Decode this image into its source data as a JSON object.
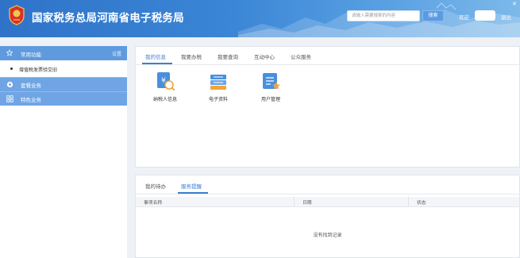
{
  "header": {
    "title": "国家税务总局河南省电子税务局",
    "emblem_icon": "tax-emblem-icon",
    "search_placeholder": "请输入需要搜索的内容",
    "search_button": "搜索",
    "welcome": "欢迎",
    "logout": "退出",
    "close_glyph": "✕",
    "colors": {
      "primary": "#3b86d6",
      "accent": "#5f9adf"
    }
  },
  "sidebar": {
    "common": {
      "label": "常用功能",
      "setting": "设置",
      "icon": "star-icon"
    },
    "sub_items": [
      {
        "label": "增值税发票验交旧"
      }
    ],
    "sections": [
      {
        "label": "套餐业务",
        "icon": "package-icon"
      },
      {
        "label": "特色业务",
        "icon": "grid-icon"
      }
    ]
  },
  "main": {
    "tabs": [
      "我的信息",
      "我要办税",
      "我要查询",
      "互动中心",
      "公众服务"
    ],
    "active_tab": "我的信息",
    "tiles": [
      {
        "label": "纳税人信息",
        "icon": "taxpayer-info-icon"
      },
      {
        "label": "电子资料",
        "icon": "e-documents-icon"
      },
      {
        "label": "用户管理",
        "icon": "user-management-icon"
      }
    ]
  },
  "bottom": {
    "tabs": [
      "我的待办",
      "服务提醒"
    ],
    "active_tab": "服务提醒",
    "columns": [
      "事项名称",
      "日期",
      "状态"
    ],
    "empty_text": "没有找到记录"
  }
}
